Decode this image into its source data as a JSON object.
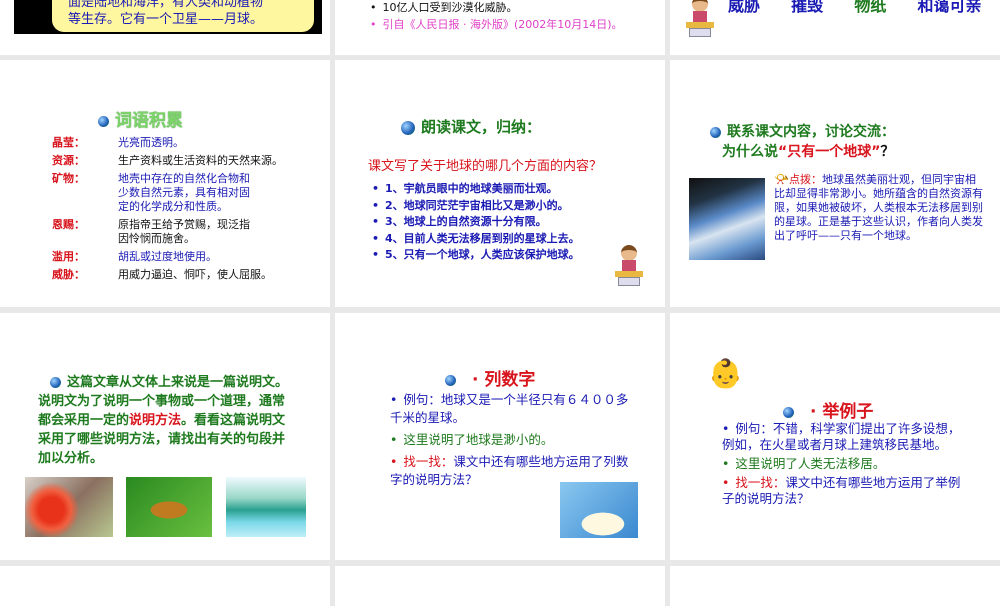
{
  "row1": {
    "s1": {
      "lines": [
        "面是陆地和海洋，有人类和动植物",
        "等生存。它有一个卫星——月球。"
      ]
    },
    "s2": {
      "bullets": [
        "10亿人口受到沙漠化威胁。"
      ],
      "source": "引自《人民日报 · 海外版》(2002年10月14日)。"
    },
    "s3": {
      "words": [
        "威胁",
        "摧毁",
        "物纸",
        "和蔼可亲"
      ]
    }
  },
  "vocab": {
    "title": "词语积累",
    "items": [
      {
        "term": "晶莹：",
        "def": "光亮而透明。",
        "color": "blue"
      },
      {
        "term": "资源：",
        "def": "生产资料或生活资料的天然来源。",
        "color": "black"
      },
      {
        "term": "矿物：",
        "def": "地壳中存在的自然化合物和少数自然元素，具有相对固定的化学成分和性质。",
        "color": "blue"
      },
      {
        "term": "恩赐：",
        "def": "原指帝王给予赏赐，现泛指因怜悯而施舍。",
        "color": "black"
      },
      {
        "term": "滥用：",
        "def": "胡乱或过度地使用。",
        "color": "blue"
      },
      {
        "term": "威胁：",
        "def": "用威力逼迫、恫吓，使人屈服。",
        "color": "black"
      }
    ]
  },
  "summary": {
    "title": "朗读课文，归纳：",
    "question": "课文写了关于地球的哪几个方面的内容？",
    "items": [
      "1、宇航员眼中的地球美丽而壮观。",
      "2、地球同茫茫宇宙相比又是渺小的。",
      "3、地球上的自然资源十分有限。",
      "4、目前人类无法移居到别的星球上去。",
      "5、只有一个地球，人类应该保护地球。"
    ]
  },
  "discuss": {
    "title": "联系课文内容，讨论交流：",
    "q_prefix": "为什么说",
    "q_quote": "“只有一个地球”",
    "q_suffix": "？",
    "hint_label": "点拨：",
    "hint": "地球虽然美丽壮观，但同宇宙相比却显得非常渺小。她所蕴含的自然资源有限，如果她被破坏，人类根本无法移居到别的星球。正是基于这些认识，作者向人类发出了呼吁——只有一个地球。"
  },
  "style": {
    "pre": "这篇文章从文体上来说是一篇说明文。说明文为了说明一个事物或一个道理，通常都会采用一定的",
    "highlight": "说明方法",
    "post": "。看看这篇说明文采用了哪些说明方法，请找出有关的句段并加以分析。"
  },
  "numbers": {
    "title": "· 列数字",
    "example": "例句：地球又是一个半径只有６４００多千米的星球。",
    "explain": "这里说明了地球是渺小的。",
    "find_label": "找一找：",
    "find": "课文中还有哪些地方运用了列数字的说明方法？"
  },
  "examples": {
    "title": "· 举例子",
    "example": "例句：不错，科学家们提出了许多设想，例如，在火星或者月球上建筑移民基地。",
    "explain": "这里说明了人类无法移居。",
    "find_label": "找一找：",
    "find": "课文中还有哪些地方运用了举例子的说明方法？"
  }
}
